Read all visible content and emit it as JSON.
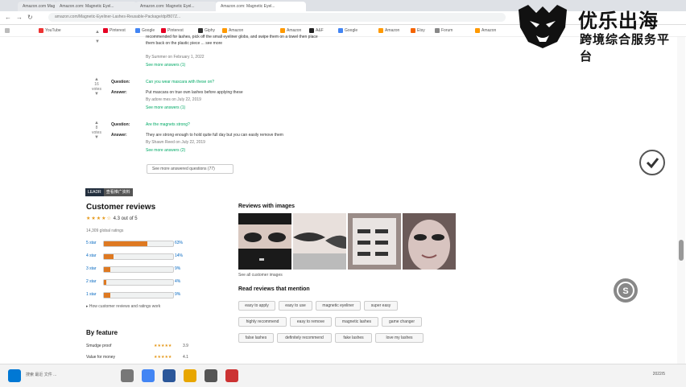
{
  "browser": {
    "tabs": [
      {
        "label": "Amazon.com Magnetic Eyelas...",
        "active": false
      },
      {
        "label": "Amazon.com: Magnetic Eyel...",
        "active": false
      },
      {
        "label": "Amazon.com: Magnetic Eyel...",
        "active": false
      },
      {
        "label": "Amazon.com: Magnetic Eyel...",
        "active": true
      }
    ],
    "url": "amazon.com/Magnetic-Eyeliner-Lashes-Reusable-Package/dp/B07Z...",
    "bookmarks": [
      "YouTube",
      "Pinterest",
      "Google",
      "Pinterest",
      "Giphy",
      "Amazon",
      "Amazon",
      "A&F",
      "Google",
      "Amazon",
      "Etsy",
      "Forum",
      "Amazon"
    ]
  },
  "watermark": {
    "title": "优乐出海",
    "subtitle": "跨境综合服务平台"
  },
  "qa": {
    "top_text_line1": "recommended for lashes, pick off the small eyeliner globs, and swipe them on a towel then place",
    "top_text_line2": "them back on the plastic piece ... see more",
    "top_by": "By Summer on February 1, 2022",
    "top_more": "See more answers (1)",
    "items": [
      {
        "votes": "16",
        "votes_label": "votes",
        "question_label": "Question:",
        "question": "Can you wear mascara with these on?",
        "answer_label": "Answer:",
        "answer": "Put mascara on true own lashes before applying these",
        "by": "By adore mes on July 22, 2019",
        "more": "See more answers (1)"
      },
      {
        "votes": "8",
        "votes_label": "votes",
        "question_label": "Question:",
        "question": "Are the magnets strong?",
        "answer_label": "Answer:",
        "answer": "They are strong enough to hold quite full day but you can easily remove them",
        "by": "By Shawn Reed on July 22, 2019",
        "more": "See more answers (2)"
      }
    ],
    "see_more_questions": "See more answered questions (77)"
  },
  "badge": {
    "part1": "LEADR",
    "part2": "查看推广资料"
  },
  "reviews": {
    "title": "Customer reviews",
    "rating_text": "4.3 out of 5",
    "stars": "★★★★☆",
    "global_ratings": "14,309 global ratings",
    "histogram": [
      {
        "label": "5 star",
        "pct": "63%",
        "value": 63
      },
      {
        "label": "4 star",
        "pct": "14%",
        "value": 14
      },
      {
        "label": "3 star",
        "pct": "9%",
        "value": 9
      },
      {
        "label": "2 star",
        "pct": "4%",
        "value": 4
      },
      {
        "label": "1 star",
        "pct": "9%",
        "value": 9
      }
    ],
    "how_calculated": "How customer reviews and ratings work",
    "by_feature_title": "By feature",
    "features": [
      {
        "name": "Smudge proof",
        "stars": "★★★★★",
        "value": "3.9"
      },
      {
        "name": "Value for money",
        "stars": "★★★★★",
        "value": "4.1"
      }
    ]
  },
  "images": {
    "title": "Reviews with images",
    "see_all": "See all customer images"
  },
  "mentions": {
    "title": "Read reviews that mention",
    "chips": [
      [
        "easy to apply",
        "easy to use",
        "magnetic eyeliner",
        "super easy"
      ],
      [
        "highly recommend",
        "easy to remove",
        "magnetic lashes",
        "game changer"
      ],
      [
        "false lashes",
        "definitely recommend",
        "fake lashes",
        "love my lashes"
      ]
    ]
  },
  "taskbar": {
    "left_text": "搜索 最近 文件 ...",
    "right_text": "2022/5"
  }
}
